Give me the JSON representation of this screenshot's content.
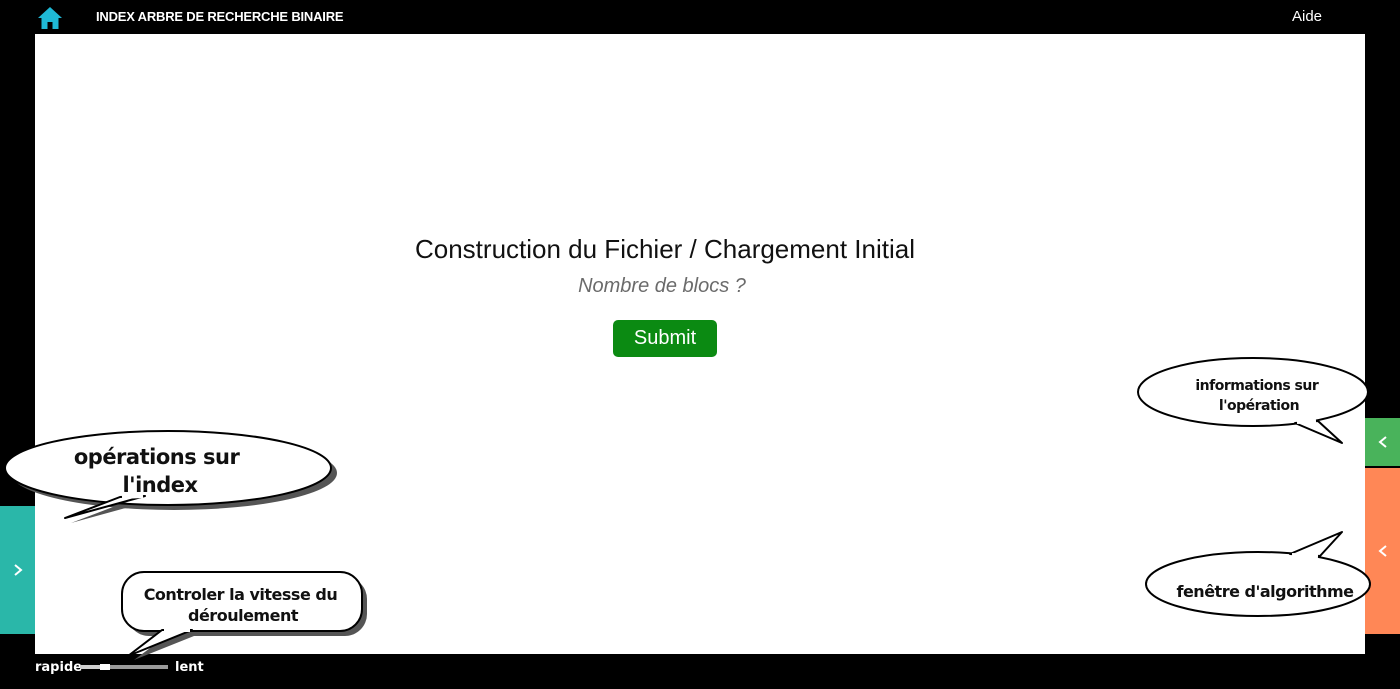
{
  "header": {
    "title": "INDEX ARBRE DE RECHERCHE BINAIRE",
    "help_label": "Aide",
    "home_icon": "home-icon"
  },
  "main": {
    "title": "Construction du Fichier / Chargement Initial",
    "blocks_placeholder": "Nombre de blocs ?",
    "blocks_value": "",
    "submit_label": "Submit"
  },
  "colors": {
    "home_icon": "#1fb9d6",
    "submit": "#0b8a12",
    "tab_operations": "#2ab7a9",
    "tab_info": "#49b35b",
    "tab_algorithm": "#ff8756"
  },
  "callouts": {
    "operations": [
      "opérations sur",
      "l'index"
    ],
    "speed": [
      "Controler la vitesse du",
      "déroulement"
    ],
    "info": [
      "informations sur",
      "l'opération"
    ],
    "algorithm": [
      "fenêtre d'algorithme"
    ]
  },
  "speed": {
    "fast_label": "rapide",
    "slow_label": "lent",
    "position": 0.25
  },
  "tabs": {
    "operations_icon": "chevron-right-icon",
    "info_icon": "chevron-left-icon",
    "algorithm_icon": "chevron-left-icon"
  }
}
